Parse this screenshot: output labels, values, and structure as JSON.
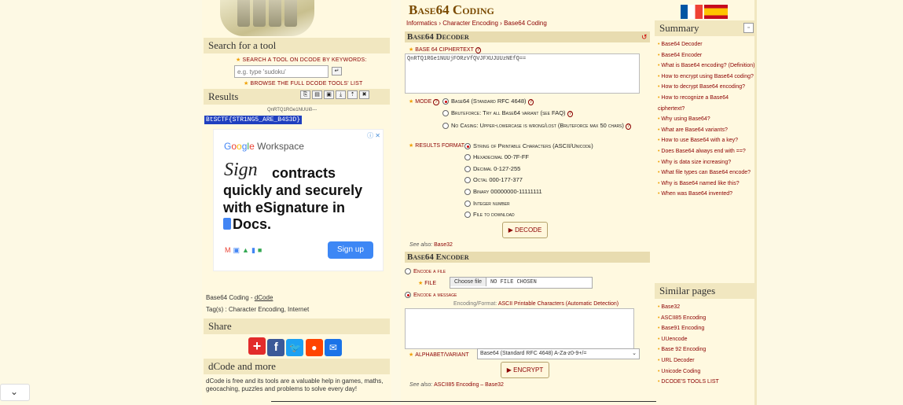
{
  "left": {
    "search_title": "Search for a tool",
    "search_hint": "Search a tool on dCode by keywords:",
    "search_placeholder": "e.g. type 'sudoku'",
    "browse_link": "Browse the full dCode tools' list",
    "results_title": "Results",
    "results_line1": "QnRTQ1RGe1NUUi0---",
    "results_highlight": "BtSCTF{STR1NG5_ARE_B4S3D}",
    "ad": {
      "brand": "Google Workspace",
      "headline": "contracts quickly and securely with eSignature in",
      "docs": "Docs.",
      "cta": "Sign up"
    },
    "meta_line1_prefix": "Base64 Coding - ",
    "meta_line1_link": "dCode",
    "meta_line2": "Tag(s) : Character Encoding, Internet",
    "share_title": "Share",
    "more_title": "dCode and more",
    "more_text": "dCode is free and its tools are a valuable help in games, maths, geocaching, puzzles and problems to solve every day!"
  },
  "main": {
    "title": "Base64 Coding",
    "breadcrumb": [
      "Informatics",
      "Character Encoding",
      "Base64 Coding"
    ],
    "decoder_title": "Base64 Decoder",
    "cipher_label": "Base 64 ciphertext",
    "cipher_value": "QnRTQ1RGe1NUUjFORzVfQVJFXUJUUzNEfQ==",
    "mode_label": "Mode",
    "mode_options": [
      "Base64 (Standard RFC 4648)",
      "Bruteforce: Try all Base64 variant (see FAQ)",
      "No Casing: Upper-lowercase is wrong/lost (Bruteforce max 50 chars)"
    ],
    "results_format_label": "Results format",
    "format_options": [
      "String of Printable Characters (ASCII/Unicode)",
      "Hexadecimal 00-7F-FF",
      "Decimal 0-127-255",
      "Octal 000-177-377",
      "Binary 00000000-11111111",
      "Integer number",
      "File to download"
    ],
    "decode_btn": "DECODE",
    "see_also_1_prefix": "See also:",
    "see_also_1_link": "Base32",
    "encoder_title": "Base64 Encoder",
    "encode_file": "Encode a file",
    "file_label": "File",
    "choose_file": "Choose file",
    "no_file": "NO FILE CHOSEN",
    "encode_message": "Encode a message",
    "encoding_format_prefix": "Encoding/Format:",
    "encoding_format_value": "ASCII Printable Characters (Automatic Detection)",
    "alphabet_label": "Alphabet/Variant",
    "alphabet_value": "Base64 (Standard RFC 4648) A-Za-z0-9+/=",
    "encrypt_btn": "ENCRYPT",
    "see_also_2_prefix": "See also:",
    "see_also_2_links": "ASCII85 Encoding – Base32"
  },
  "right": {
    "summary_title": "Summary",
    "summary_items": [
      "Base64 Decoder",
      "Base64 Encoder",
      "What is Base64 encoding? (Definition)",
      "How to encrypt using Base64 coding?",
      "How to decrypt Base64 encoding?",
      "How to recognize a Base64 ciphertext?",
      "Why using Base64?",
      "What are Base64 variants?",
      "How to use Base64 with a key?",
      "Does Base64 always end with ==?",
      "Why is data size increasing?",
      "What file types can Base64 encode?",
      "Why is Base64 named like this?",
      "When was Base64 invented?"
    ],
    "similar_title": "Similar pages",
    "similar_items": [
      "Base32",
      "ASCII85 Encoding",
      "Base91 Encoding",
      "UUencode",
      "Base 92 Encoding",
      "URL Decoder",
      "Unicode Coding",
      "DCODE'S TOOLS LIST"
    ]
  },
  "colors": {
    "accent": "#8b0000",
    "panel": "#f1e7c0",
    "highlight": "#1f3fbf"
  }
}
